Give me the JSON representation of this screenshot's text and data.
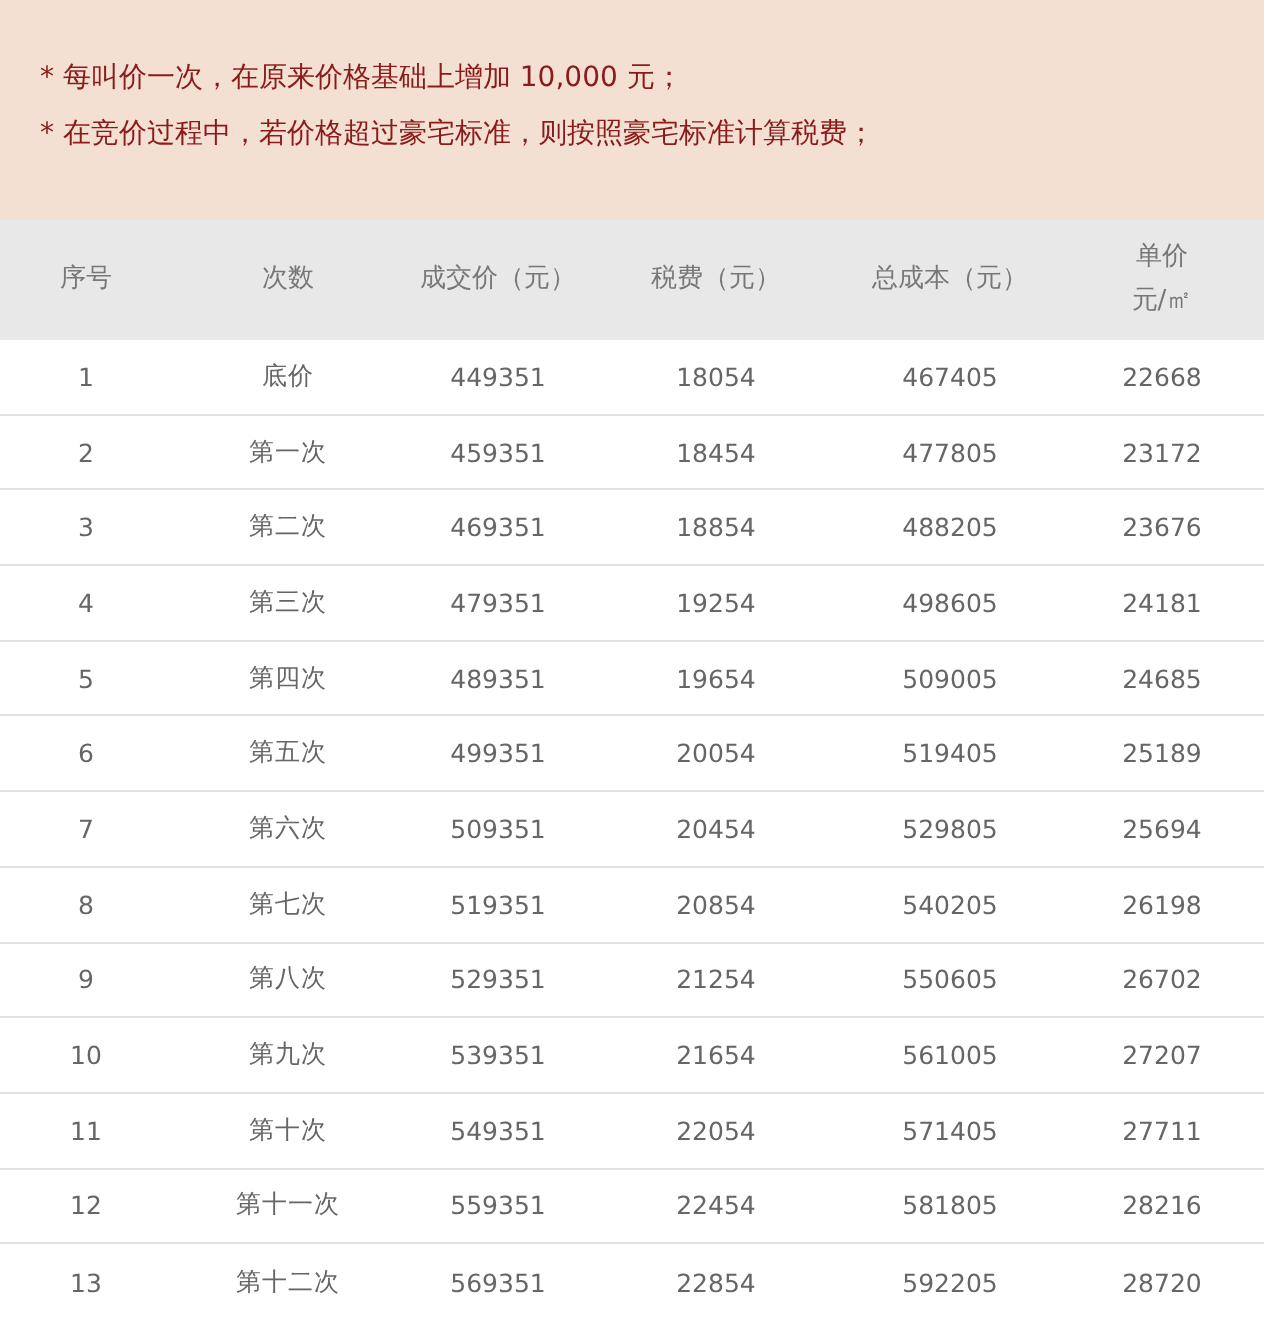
{
  "notes": [
    "* 每叫价一次，在原来价格基础上增加 10,000 元；",
    "* 在竞价过程中，若价格超过豪宅标准，则按照豪宅标准计算税费；"
  ],
  "table": {
    "columns": [
      "序号",
      "次数",
      "成交价（元）",
      "税费（元）",
      "总成本（元）",
      [
        "单价",
        "元/㎡"
      ]
    ],
    "rows": [
      [
        "1",
        "底价",
        "449351",
        "18054",
        "467405",
        "22668"
      ],
      [
        "2",
        "第一次",
        "459351",
        "18454",
        "477805",
        "23172"
      ],
      [
        "3",
        "第二次",
        "469351",
        "18854",
        "488205",
        "23676"
      ],
      [
        "4",
        "第三次",
        "479351",
        "19254",
        "498605",
        "24181"
      ],
      [
        "5",
        "第四次",
        "489351",
        "19654",
        "509005",
        "24685"
      ],
      [
        "6",
        "第五次",
        "499351",
        "20054",
        "519405",
        "25189"
      ],
      [
        "7",
        "第六次",
        "509351",
        "20454",
        "529805",
        "25694"
      ],
      [
        "8",
        "第七次",
        "519351",
        "20854",
        "540205",
        "26198"
      ],
      [
        "9",
        "第八次",
        "529351",
        "21254",
        "550605",
        "26702"
      ],
      [
        "10",
        "第九次",
        "539351",
        "21654",
        "561005",
        "27207"
      ],
      [
        "11",
        "第十次",
        "549351",
        "22054",
        "571405",
        "27711"
      ],
      [
        "12",
        "第十一次",
        "559351",
        "22454",
        "581805",
        "28216"
      ],
      [
        "13",
        "第十二次",
        "569351",
        "22854",
        "592205",
        "28720"
      ]
    ]
  }
}
